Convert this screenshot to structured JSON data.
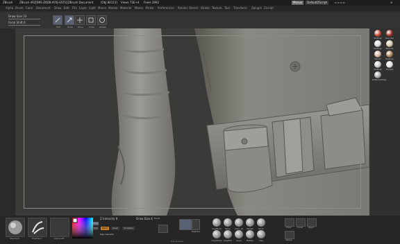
{
  "app": {
    "window_title": "ZBrush",
    "title_segments": [
      "ZBrush 4R2[B9S-Z6DB-AYXJ-GSTQ]",
      "ZBrush Document",
      "[Obj 84113]",
      "Views 73E+4",
      "Frees 2892"
    ]
  },
  "menu": {
    "items": [
      "Alpha",
      "Brush",
      "Color",
      "Document",
      "Draw",
      "Edit",
      "File",
      "Layer",
      "Light",
      "Macro",
      "Marker",
      "Material",
      "Movie",
      "Picker",
      "Preferences",
      "Render",
      "Stencil",
      "Stroke",
      "Texture",
      "Tool",
      "Transform",
      "Zplugin",
      "Zscript"
    ],
    "right_buttons": [
      "Menus",
      "DefaultZScript"
    ]
  },
  "shelf": {
    "draw_size_label": "Draw Size 53",
    "focal_shift_label": "Focal Shift 0",
    "tools": [
      {
        "label": "Edit",
        "icon": "edit-icon",
        "active": true
      },
      {
        "label": "Draw",
        "icon": "draw-icon",
        "active": true
      },
      {
        "label": "Move",
        "icon": "move-icon",
        "active": false
      },
      {
        "label": "Scale",
        "icon": "scale-icon",
        "active": false
      },
      {
        "label": "Rotate",
        "icon": "rotate-icon",
        "active": false
      }
    ]
  },
  "materials": [
    {
      "label": "MatCap",
      "color": "#c7432e"
    },
    {
      "label": "Red_Wa",
      "color": "#a02f21"
    },
    {
      "label": "MatCap",
      "color": "#d8d8d8"
    },
    {
      "label": "BasicM",
      "color": "#d1c4a8"
    },
    {
      "label": "SkinSh",
      "color": "#d0b0a0"
    },
    {
      "label": "MatCap",
      "color": "#a37e52"
    },
    {
      "label": "MatCap",
      "color": "#c7c7c7"
    },
    {
      "label": "Toyplst",
      "color": "#e0e0e0"
    },
    {
      "label": "ReflectedMap",
      "color": "#a9a9a9"
    }
  ],
  "bottom": {
    "brush_labels": [
      "Standard",
      "FreeHand",
      "Alpha Off"
    ],
    "intensity_label": "Z Intensity 8",
    "rgb_label": "Rgb",
    "mrgb_label": "Mrgb",
    "zadd_label": "Zadd",
    "zsub_label": "Zsub",
    "sculptris_label": "Sculptris",
    "rgb_intensity_label": "Rgb Intensity",
    "draw_size_label": "Draw Size 4",
    "focal_label": "Focal",
    "zsphere_label": "Zsphere",
    "stroke_labels": [
      "ClayBuild",
      "Move",
      "Dam_St",
      "hPolish",
      "Pinch"
    ],
    "stroke_labels_2": [
      "ClayTubes",
      "ClayBuil",
      "Layer",
      "Flatten",
      "Clay"
    ],
    "right_icons": [
      "Floor",
      "Local",
      "LSym",
      "Xpose"
    ],
    "bottom_hint": "Transparent",
    "accent": "#596273"
  }
}
